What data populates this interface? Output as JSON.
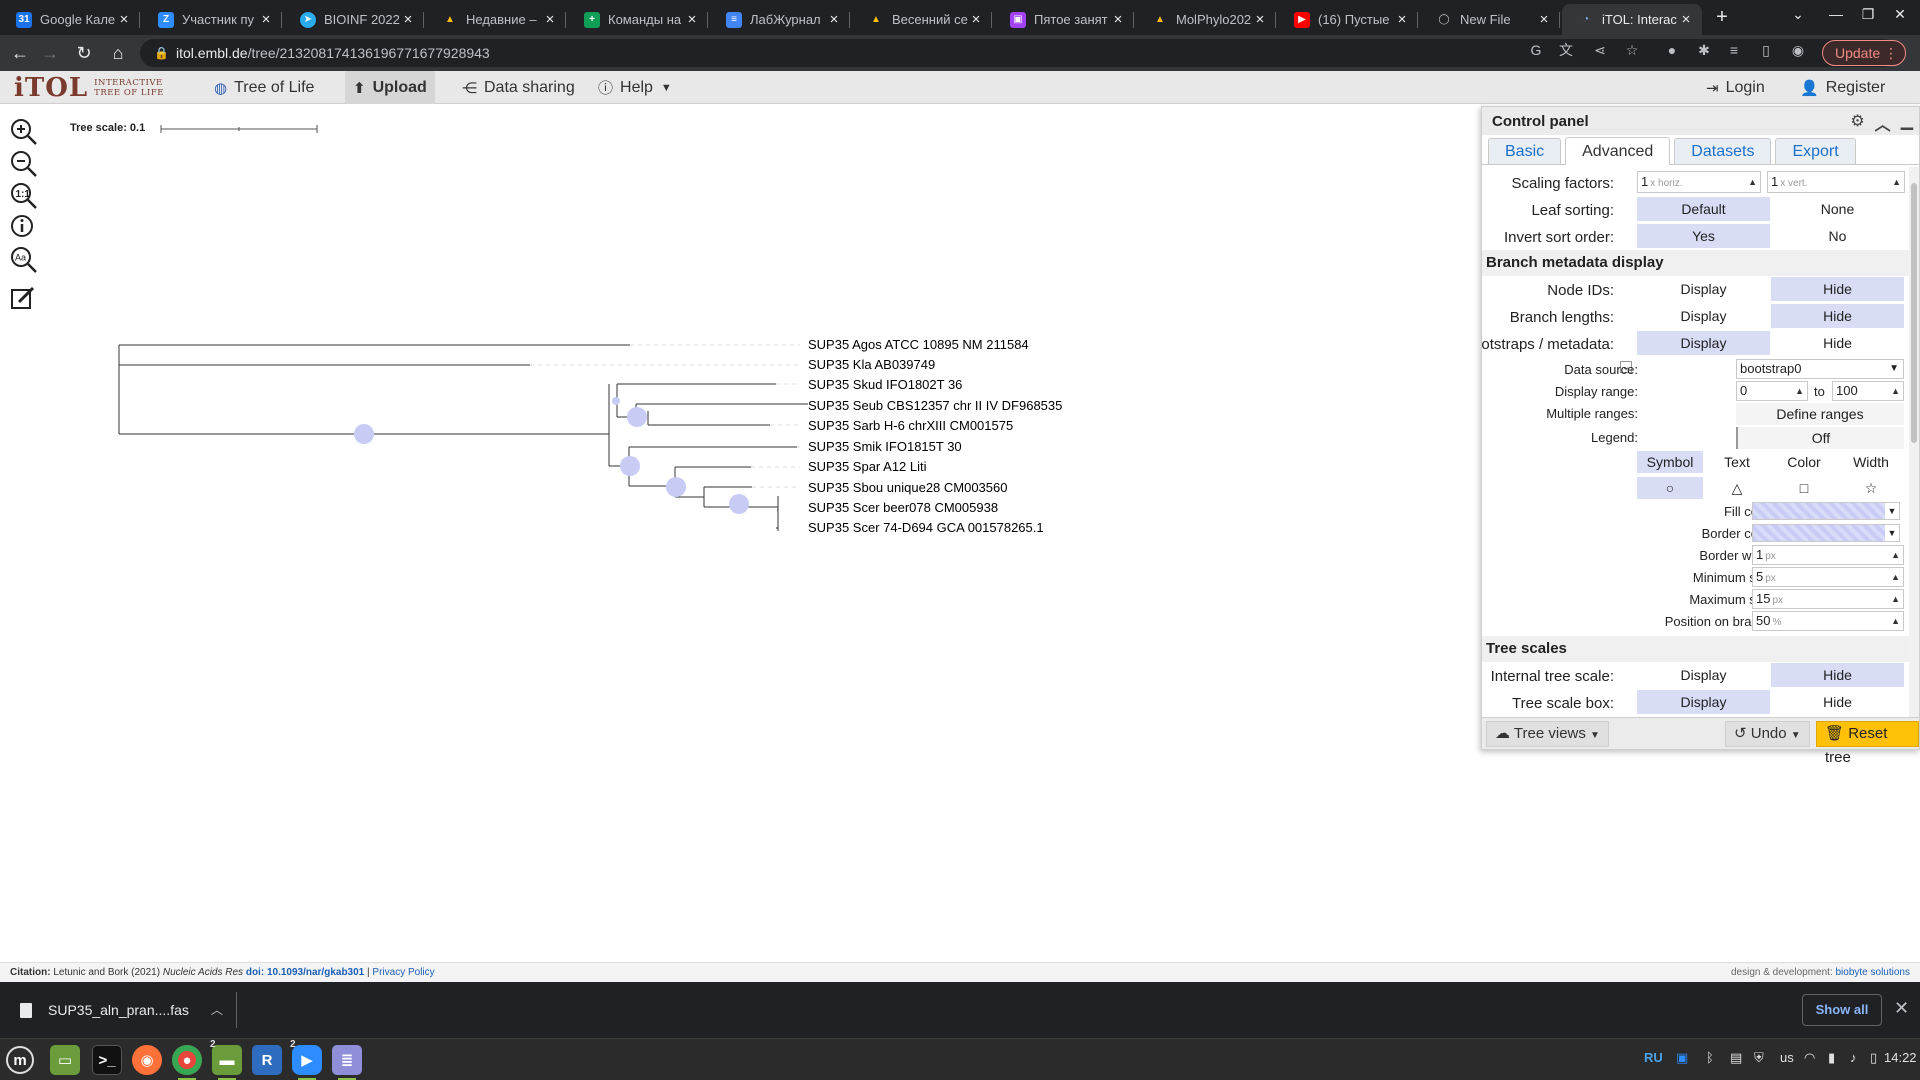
{
  "browser": {
    "tabs": [
      {
        "title": "Google Кале",
        "color": "#1a73e8",
        "glyph": "31"
      },
      {
        "title": "Участник пу",
        "color": "#2d8cff",
        "glyph": "Z"
      },
      {
        "title": "BIOINF 2022/",
        "color": "#2aabee",
        "glyph": "➤"
      },
      {
        "title": "Недавние –",
        "color": "#fbbc04",
        "glyph": "▲"
      },
      {
        "title": "Команды на",
        "color": "#0f9d58",
        "glyph": "+"
      },
      {
        "title": "ЛабЖурнал",
        "color": "#4285f4",
        "glyph": "≡"
      },
      {
        "title": "Весенний се",
        "color": "#fbbc04",
        "glyph": "▲"
      },
      {
        "title": "Пятое занят",
        "color": "#a142f4",
        "glyph": "▣"
      },
      {
        "title": "MolPhylo202",
        "color": "#fbbc04",
        "glyph": "▲"
      },
      {
        "title": "(16) Пустые",
        "color": "#ff0000",
        "glyph": "▶"
      },
      {
        "title": "New File",
        "color": "#202124",
        "glyph": "◯"
      },
      {
        "title": "iTOL: Interac",
        "color": "#1a73e8",
        "glyph": "◔"
      }
    ],
    "url_host": "itol.embl.de",
    "url_path": "/tree/213208174136196771677928943",
    "update_label": "Update"
  },
  "itol": {
    "logo_big": "iTOL",
    "logo_small_1": "Interactive",
    "logo_small_2": "Tree Of Life",
    "menu": {
      "tree_of_life": "Tree of Life",
      "upload": "Upload",
      "data_sharing": "Data sharing",
      "help": "Help",
      "login": "Login",
      "register": "Register"
    }
  },
  "tree": {
    "scale_label": "Tree scale: 0.1",
    "leaves": [
      "SUP35 Agos ATCC 10895 NM 211584",
      "SUP35 Kla AB039749",
      "SUP35 Skud IFO1802T 36",
      "SUP35 Seub CBS12357 chr II IV DF968535",
      "SUP35 Sarb H-6 chrXIII CM001575",
      "SUP35 Smik IFO1815T 30",
      "SUP35 Spar A12 Liti",
      "SUP35 Sbou unique28 CM003560",
      "SUP35 Scer beer078 CM005938",
      "SUP35 Scer 74-D694 GCA 001578265.1"
    ],
    "bootstrap_color": "#c8ccf5"
  },
  "control_panel": {
    "title": "Control panel",
    "tabs": [
      "Basic",
      "Advanced",
      "Datasets",
      "Export"
    ],
    "scaling_factors_label": "Scaling factors:",
    "scale_horiz_value": "1",
    "scale_horiz_unit": "x horiz.",
    "scale_vert_value": "1",
    "scale_vert_unit": "x vert.",
    "leaf_sorting_label": "Leaf sorting:",
    "leaf_sorting_options": [
      "Default",
      "None"
    ],
    "invert_sort_label": "Invert sort order:",
    "yes": "Yes",
    "no": "No",
    "branch_meta_heading": "Branch metadata display",
    "node_ids_label": "Node IDs:",
    "branch_lengths_label": "Branch lengths:",
    "bootstraps_label": "Bootstraps / metadata:",
    "display": "Display",
    "hide": "Hide",
    "data_source_label": "Data source:",
    "data_source_value": "bootstrap0",
    "display_range_label": "Display range:",
    "range_from": "0",
    "range_to_label": "to",
    "range_to": "100",
    "multiple_ranges_label": "Multiple ranges:",
    "define_ranges": "Define ranges",
    "legend_label": "Legend:",
    "legend_value": "Off",
    "style_tabs": [
      "Symbol",
      "Text",
      "Color",
      "Width"
    ],
    "fill_color_label": "Fill color:",
    "border_color_label": "Border color:",
    "border_width_label": "Border width:",
    "border_width_value": "1",
    "min_size_label": "Minimum size:",
    "min_size_value": "5",
    "max_size_label": "Maximum size:",
    "max_size_value": "15",
    "position_label": "Position on branch:",
    "position_value": "50",
    "px": "px",
    "percent": "%",
    "tree_scales_heading": "Tree scales",
    "internal_scale_label": "Internal tree scale:",
    "scale_box_label": "Tree scale box:",
    "tree_views": "Tree views",
    "undo": "Undo",
    "reset_tree": "Reset tree"
  },
  "citation": {
    "label": "Citation:",
    "authors": "Letunic and Bork (2021)",
    "journal": "Nucleic Acids Res",
    "doi": "doi: 10.1093/nar/gkab301",
    "separator": "|",
    "privacy": "Privacy Policy",
    "design_label": "design & development:",
    "design_link": "biobyte solutions"
  },
  "downloads": {
    "file": "SUP35_aln_pran....fas",
    "show_all": "Show all"
  },
  "taskbar": {
    "lang": "RU",
    "kbd": "us",
    "time": "14:22",
    "badge_files": "2",
    "badge_zoom": "2"
  }
}
